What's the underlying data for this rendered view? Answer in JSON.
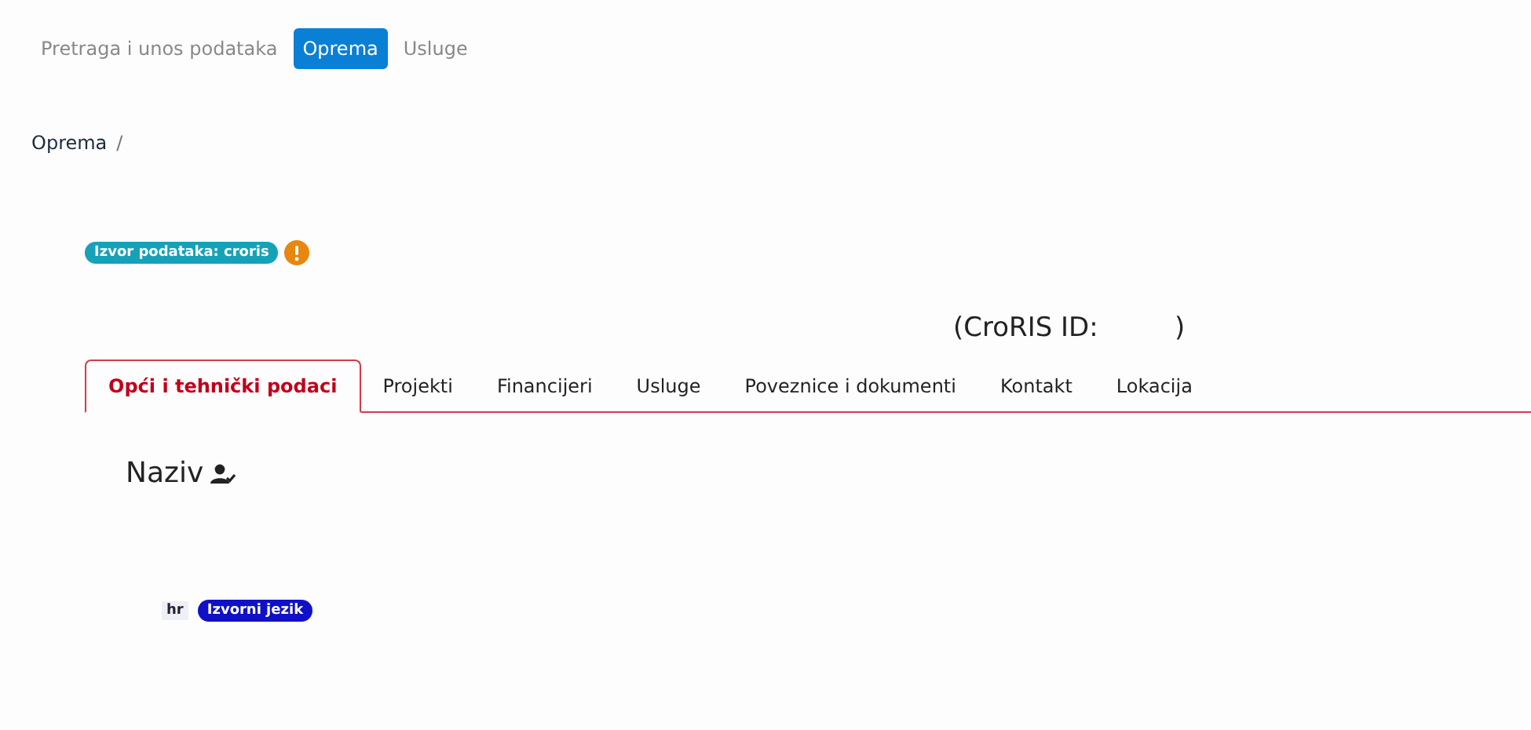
{
  "nav": [
    {
      "label": "Pretraga i unos podataka",
      "selected": false
    },
    {
      "label": "Oprema",
      "selected": true
    },
    {
      "label": "Usluge",
      "selected": false
    }
  ],
  "breadcrumb": [
    "Oprema",
    "/"
  ],
  "source_badge": "Izvor podataka: croris",
  "croris_id": "(CroRIS ID:         )",
  "tabs": [
    {
      "label": "Opći i tehnički podaci",
      "selected": true
    },
    {
      "label": "Projekti",
      "selected": false
    },
    {
      "label": "Financijeri",
      "selected": false
    },
    {
      "label": "Usluge",
      "selected": false
    },
    {
      "label": "Poveznice i dokumenti",
      "selected": false
    },
    {
      "label": "Kontakt",
      "selected": false
    },
    {
      "label": "Lokacija",
      "selected": false
    }
  ],
  "field_label": "Naziv",
  "language": {
    "code": "hr",
    "badge": "Izvorni jezik"
  }
}
